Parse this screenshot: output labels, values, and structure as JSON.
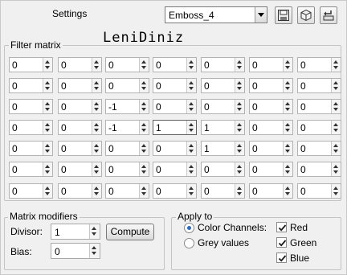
{
  "header": {
    "settings_label": "Settings",
    "preset_value": "Emboss_4",
    "save_icon": "save-icon",
    "preset_icon": "preset-cube-icon",
    "reset_icon": "reset-arrow-icon"
  },
  "filter_matrix": {
    "title": "Filter matrix",
    "watermark": "LeniDiniz",
    "rows": [
      [
        "0",
        "0",
        "0",
        "0",
        "0",
        "0",
        "0"
      ],
      [
        "0",
        "0",
        "0",
        "0",
        "0",
        "0",
        "0"
      ],
      [
        "0",
        "0",
        "-1",
        "0",
        "0",
        "0",
        "0"
      ],
      [
        "0",
        "0",
        "-1",
        "1",
        "1",
        "0",
        "0"
      ],
      [
        "0",
        "0",
        "0",
        "0",
        "1",
        "0",
        "0"
      ],
      [
        "0",
        "0",
        "0",
        "0",
        "0",
        "0",
        "0"
      ],
      [
        "0",
        "0",
        "0",
        "0",
        "0",
        "0",
        "0"
      ]
    ]
  },
  "modifiers": {
    "title": "Matrix modifiers",
    "divisor_label": "Divisor:",
    "divisor_value": "1",
    "compute_label": "Compute",
    "bias_label": "Bias:",
    "bias_value": "0"
  },
  "apply_to": {
    "title": "Apply to",
    "color_channels_label": "Color Channels:",
    "grey_values_label": "Grey values",
    "selected": "color_channels",
    "channels": [
      {
        "label": "Red",
        "checked": true
      },
      {
        "label": "Green",
        "checked": true
      },
      {
        "label": "Blue",
        "checked": true
      }
    ]
  },
  "colors": {
    "background": "#f0f0f0",
    "radio_dot": "#2a6bc2"
  }
}
